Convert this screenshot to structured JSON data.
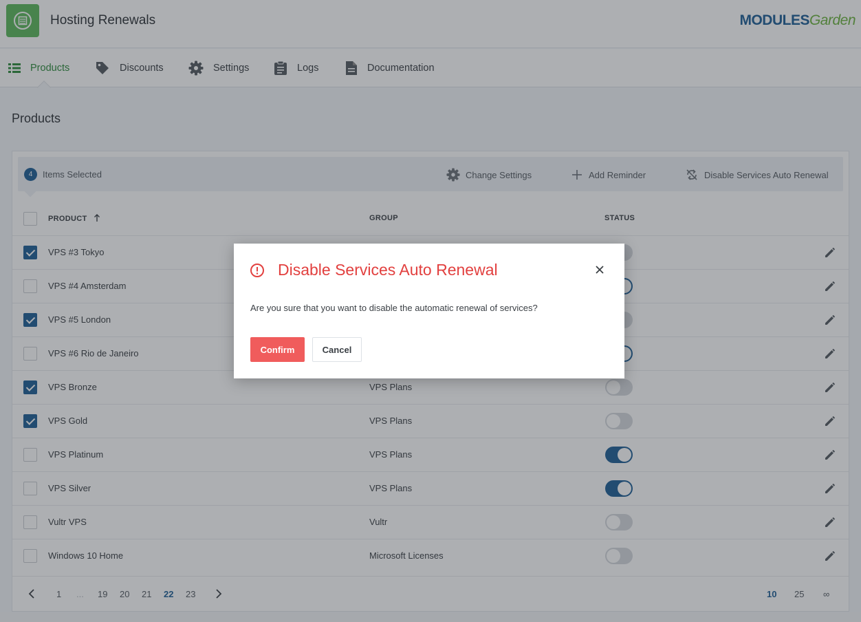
{
  "app": {
    "title": "Hosting Renewals",
    "logo_primary": "MODULES",
    "logo_secondary": "Garden"
  },
  "nav": {
    "items": [
      {
        "label": "Products",
        "icon": "table-icon",
        "active": true
      },
      {
        "label": "Discounts",
        "icon": "tag-icon"
      },
      {
        "label": "Settings",
        "icon": "gear-icon"
      },
      {
        "label": "Logs",
        "icon": "clipboard-icon"
      },
      {
        "label": "Documentation",
        "icon": "document-icon"
      }
    ]
  },
  "page": {
    "title": "Products"
  },
  "selection": {
    "count": "4",
    "label": "Items Selected",
    "actions": [
      {
        "label": "Change Settings",
        "icon": "gear-icon"
      },
      {
        "label": "Add Reminder",
        "icon": "plus-icon"
      },
      {
        "label": "Disable Services Auto Renewal",
        "icon": "sync-off-icon"
      }
    ]
  },
  "table": {
    "columns": {
      "product": "PRODUCT",
      "group": "GROUP",
      "status": "STATUS"
    },
    "rows": [
      {
        "product": "VPS #3 Tokyo",
        "group": "",
        "checked": true,
        "status_on": false
      },
      {
        "product": "VPS #4 Amsterdam",
        "group": "",
        "checked": false,
        "status_on": true
      },
      {
        "product": "VPS #5 London",
        "group": "",
        "checked": true,
        "status_on": false
      },
      {
        "product": "VPS #6 Rio de Janeiro",
        "group": "",
        "checked": false,
        "status_on": true
      },
      {
        "product": "VPS Bronze",
        "group": "VPS Plans",
        "checked": true,
        "status_on": false
      },
      {
        "product": "VPS Gold",
        "group": "VPS Plans",
        "checked": true,
        "status_on": false
      },
      {
        "product": "VPS Platinum",
        "group": "VPS Plans",
        "checked": false,
        "status_on": true
      },
      {
        "product": "VPS Silver",
        "group": "VPS Plans",
        "checked": false,
        "status_on": true
      },
      {
        "product": "Vultr VPS",
        "group": "Vultr",
        "checked": false,
        "status_on": false
      },
      {
        "product": "Windows 10 Home",
        "group": "Microsoft Licenses",
        "checked": false,
        "status_on": false
      }
    ]
  },
  "pagination": {
    "pages": [
      "1",
      "...",
      "19",
      "20",
      "21",
      "22",
      "23"
    ],
    "current": "22",
    "page_sizes": [
      "10",
      "25",
      "∞"
    ],
    "current_size": "10"
  },
  "modal": {
    "title": "Disable Services Auto Renewal",
    "message": "Are you sure that you want to disable the automatic renewal of services?",
    "confirm_label": "Confirm",
    "cancel_label": "Cancel"
  },
  "colors": {
    "accent": "#1f5f96",
    "active_nav": "#2e8b3d",
    "danger": "#e2403f",
    "confirm_button": "#f05c5c"
  }
}
